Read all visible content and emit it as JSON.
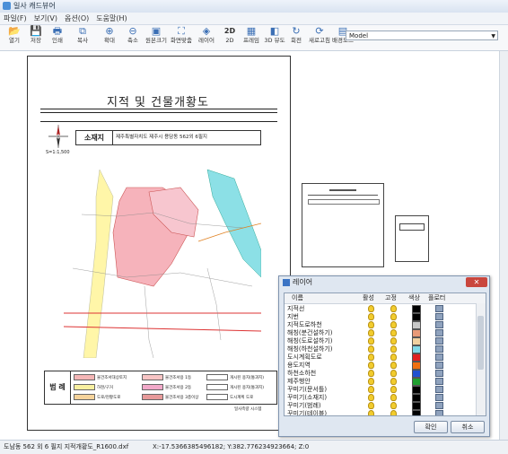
{
  "app": {
    "title": "일사 캐드뷰어"
  },
  "menu": [
    "파일(F)",
    "보기(V)",
    "옵션(O)",
    "도움말(H)"
  ],
  "toolbar": [
    {
      "label": "열기",
      "icon": "folder-icon"
    },
    {
      "label": "저장",
      "icon": "save-icon"
    },
    {
      "label": "인쇄",
      "icon": "print-icon"
    },
    {
      "label": "복사",
      "icon": "copy-icon"
    },
    {
      "label": "확대",
      "icon": "zoom-in-icon"
    },
    {
      "label": "축소",
      "icon": "zoom-out-icon"
    },
    {
      "label": "원본크기",
      "icon": "original-size-icon"
    },
    {
      "label": "화면맞춤",
      "icon": "fit-screen-icon"
    },
    {
      "label": "레이어",
      "icon": "layers-icon"
    },
    {
      "label": "2D",
      "icon": "2d-icon"
    },
    {
      "label": "프레임",
      "icon": "frame-icon"
    },
    {
      "label": "3D 뷰도",
      "icon": "3d-view-icon"
    },
    {
      "label": "회전",
      "icon": "rotate-icon"
    },
    {
      "label": "새로고침",
      "icon": "refresh-icon"
    },
    {
      "label": "배경모드",
      "icon": "background-icon"
    }
  ],
  "view_select": {
    "value": "Model"
  },
  "sheet": {
    "title": "지적 및 건물개황도",
    "location_label": "소재지",
    "location_value": "제주특별자치도 제주시 용담동 562외 6필지",
    "scale": "S=1:1,500",
    "legend_title": "범 례",
    "legend": [
      {
        "label": "물건조서대상토지",
        "color": "#f4b6b6"
      },
      {
        "label": "물건조서용 1등",
        "color": "#f7c4c4"
      },
      {
        "label": "개시된 용지(통과지)",
        "color": "#ffffff"
      },
      {
        "label": "하천/구거",
        "color": "#f8f0a0"
      },
      {
        "label": "물건조서용 2등",
        "color": "#f2a9c9"
      },
      {
        "label": "개시된 용지(통과지)",
        "color": "#ffffff"
      },
      {
        "label": "도로/현황도로",
        "color": "#f5d39b"
      },
      {
        "label": "물건조서용 3층이상",
        "color": "#e79a9a"
      },
      {
        "label": "도시계획 도로",
        "color": "#ffffff"
      }
    ],
    "footer": "일사측량 시스템"
  },
  "layer_dialog": {
    "title": "레이어",
    "columns": [
      "이름",
      "활성",
      "고정",
      "색상",
      "플로터"
    ],
    "rows": [
      {
        "name": "지적선",
        "color": "#000000"
      },
      {
        "name": "지번",
        "color": "#000000"
      },
      {
        "name": "지적도로하천",
        "color": "#c8c8c8"
      },
      {
        "name": "해칭(분건설하기)",
        "color": "#e89a78"
      },
      {
        "name": "해칭(도로설하기)",
        "color": "#f0d0a0"
      },
      {
        "name": "해칭(하천설하기)",
        "color": "#80d8e8"
      },
      {
        "name": "도시계획도로",
        "color": "#e02020"
      },
      {
        "name": "용도지역",
        "color": "#f07010"
      },
      {
        "name": "하천소하천",
        "color": "#2050d0"
      },
      {
        "name": "제주행안",
        "color": "#20a030"
      },
      {
        "name": "꾸미기(문서틀)",
        "color": "#000000"
      },
      {
        "name": "꾸미기(소재지)",
        "color": "#000000"
      },
      {
        "name": "꾸미기(범례)",
        "color": "#000000"
      },
      {
        "name": "꾸미기(테이블)",
        "color": "#000000"
      }
    ],
    "ok": "확인",
    "cancel": "취소"
  },
  "status": {
    "file": "도남동 562 외 6 필지 지적개황도_R1600.dxf",
    "coords": "X:-17.5366385496182; Y:382.776234923664; Z:0"
  }
}
